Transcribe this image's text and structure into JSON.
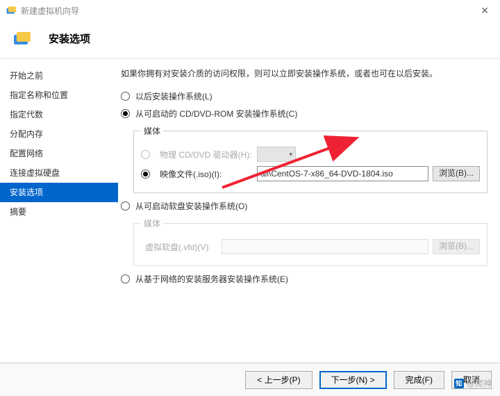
{
  "window": {
    "title": "新建虚拟机向导",
    "close": "✕"
  },
  "header": {
    "title": "安装选项"
  },
  "sidebar": {
    "steps": [
      "开始之前",
      "指定名称和位置",
      "指定代数",
      "分配内存",
      "配置网络",
      "连接虚拟硬盘",
      "安装选项",
      "摘要"
    ],
    "activeIndex": 6
  },
  "content": {
    "intro": "如果你拥有对安装介质的访问权限，则可以立即安装操作系统，或者也可在以后安装。",
    "opt_later": "以后安装操作系统(L)",
    "opt_cd": "从可启动的 CD/DVD-ROM 安装操作系统(C)",
    "media_legend": "媒体",
    "phys_label": "物理 CD/DVD 驱动器(H):",
    "iso_label": "映像文件(.iso)(I):",
    "iso_value": "all\\CentOS-7-x86_64-DVD-1804.iso",
    "browse": "浏览(B)...",
    "opt_floppy": "从可启动软盘安装操作系统(O)",
    "floppy_legend": "媒体",
    "vfd_label": "虚拟软盘(.vfd)(V):",
    "opt_net": "从基于网络的安装服务器安装操作系统(E)"
  },
  "footer": {
    "prev": "< 上一步(P)",
    "next": "下一步(N) >",
    "finish": "完成(F)",
    "cancel": "取消"
  },
  "watermark": {
    "text": "@爬神"
  }
}
